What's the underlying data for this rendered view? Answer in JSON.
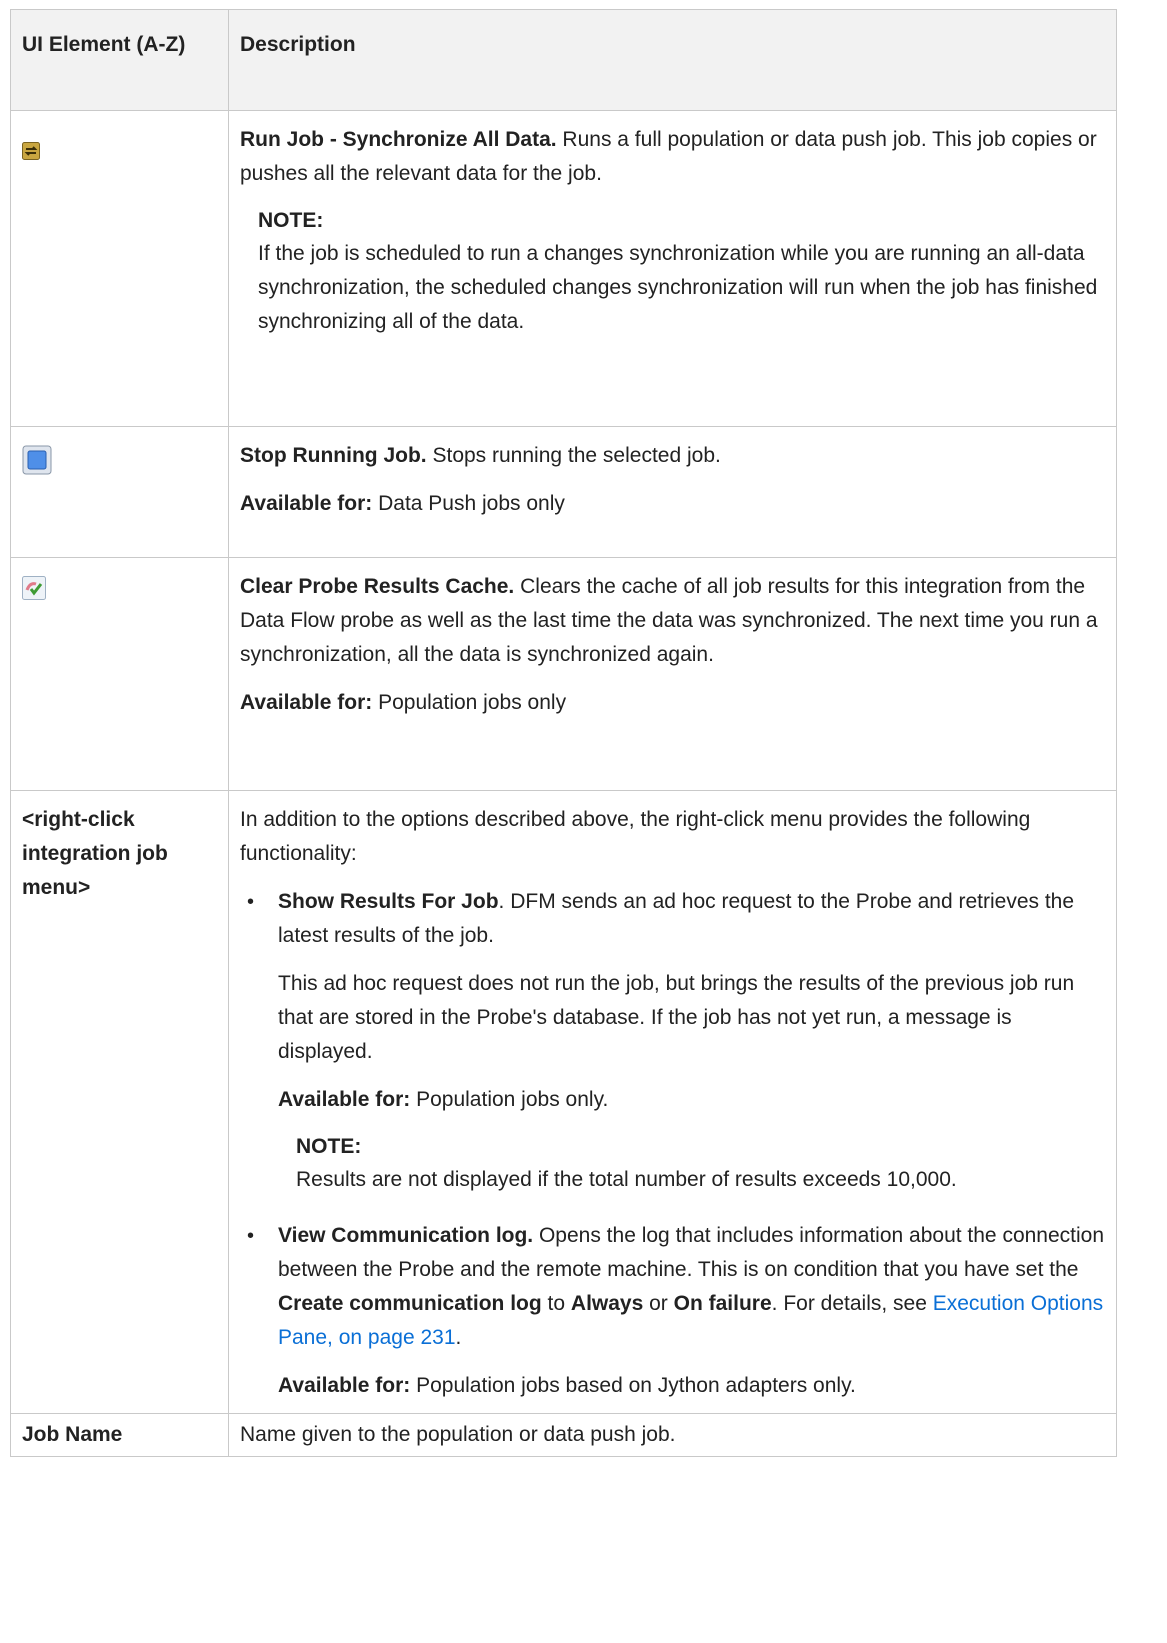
{
  "header": {
    "col1": "UI Element (A-Z)",
    "col2": "Description"
  },
  "rows": [
    {
      "icon": "sync-arrows-icon",
      "title": "Run Job - Synchronize All Data.",
      "text": " Runs a full population or data push job. This job copies or pushes all the relevant data for the job.",
      "note_title": "NOTE:",
      "note_text": "If the job is scheduled to run a changes synchronization while you are running an all-data synchronization, the scheduled changes synchronization will run when the job has finished synchronizing all of the data."
    },
    {
      "icon": "stop-square-icon",
      "title": "Stop Running Job.",
      "text": " Stops running the selected job.",
      "avail_label": "Available for:",
      "avail_text": " Data Push jobs only"
    },
    {
      "icon": "clear-cache-icon",
      "title": "Clear Probe Results Cache.",
      "text": " Clears the cache of all job results for this integration from the Data Flow probe as well as the last time the data was synchronized. The next time you run a synchronization, all the data is synchronized again.",
      "avail_label": "Available for:",
      "avail_text": " Population jobs only"
    },
    {
      "element": "<right-click integration job menu>",
      "intro": "In addition to the options described above, the right-click menu provides the following functionality:",
      "bullets": [
        {
          "title": "Show Results For Job",
          "text": ". DFM sends an ad hoc request to the Probe and retrieves the latest results of the job.",
          "extra": "This ad hoc request does not run the job, but brings the results of the previous job run that are stored in the Probe's database. If the job has not yet run, a message is displayed.",
          "avail_label": "Available for:",
          "avail_text": " Population jobs only.",
          "note_title": "NOTE:",
          "note_text": "Results are not displayed if the total number of results exceeds 10,000."
        },
        {
          "title": "View Communication log.",
          "text_a": " Opens the log that includes information about the connection between the Probe and the remote machine. This is on condition that you have set the ",
          "bold_a": "Create communication log",
          "text_b": " to ",
          "bold_b": "Always",
          "text_c": " or ",
          "bold_c": "On failure",
          "text_d": ". For details, see ",
          "link": "Execution Options Pane, on page 231",
          "text_e": ".",
          "avail_label": "Available for:",
          "avail_text": " Population jobs based on Jython adapters only."
        }
      ]
    },
    {
      "element": "Job Name",
      "text": "Name given to the population or data push job."
    }
  ],
  "bullet_char": "•"
}
